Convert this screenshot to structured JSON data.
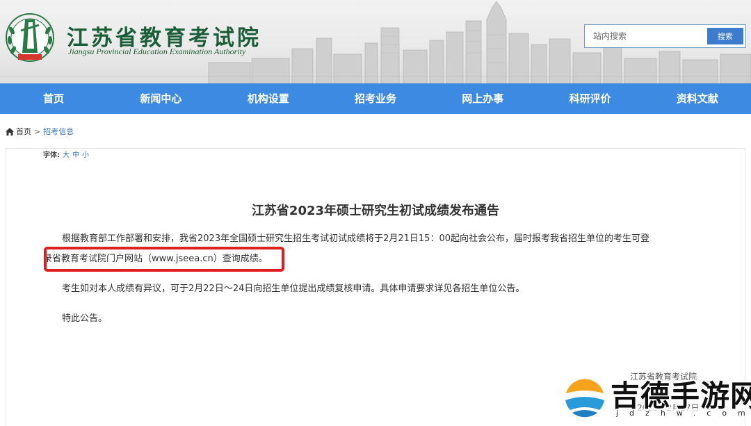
{
  "header": {
    "site_title": "江苏省教育考试院",
    "site_subtitle": "Jiangsu Provincial Education Examination Authority"
  },
  "search": {
    "placeholder": "站内搜索",
    "button_label": "搜索"
  },
  "nav": {
    "items": [
      "首页",
      "新闻中心",
      "机构设置",
      "招考业务",
      "网上办事",
      "科研评价",
      "资料文献"
    ]
  },
  "breadcrumb": {
    "home": "首页",
    "separator": ">",
    "current": "招考信息"
  },
  "font_size": {
    "label": "字体:",
    "options": [
      "大",
      "中",
      "小"
    ]
  },
  "article": {
    "title": "江苏省2023年硕士研究生初试成绩发布通告",
    "p1_line1": "根据教育部工作部署和安排，我省2023年全国硕士研究生招生考试初试成绩将于2月21日15：00起向社会公布，届时报考我省招生单位的考生可登",
    "p1_line2": "录省教育考试院门户网站（www.jseea.cn）查询成绩。",
    "p2": "考生如对本人成绩有异议，可于2月22日～24日向招生单位提出成绩复核申请。具体申请要求详见各招生单位公告。",
    "p3": "特此公告。",
    "signature": "江苏省教育考试院",
    "date": "2023年2月17日"
  },
  "watermark": {
    "name": "吉德手游网",
    "domain": "jdzhw.com"
  },
  "colors": {
    "nav_bg": "#3d8ae2",
    "logo_green": "#1a5e38",
    "highlight_red": "#e02020",
    "link_blue": "#3a77c2"
  }
}
